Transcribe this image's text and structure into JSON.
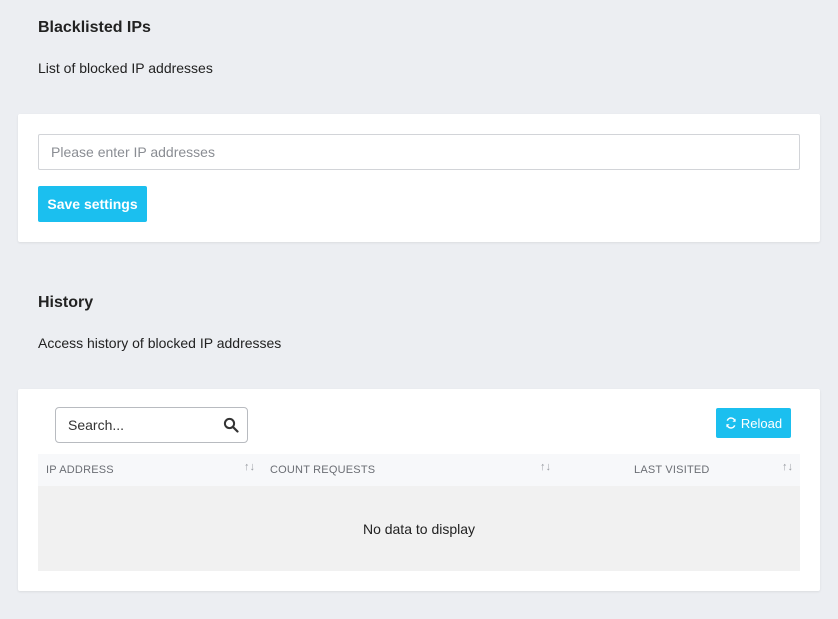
{
  "blacklist": {
    "title": "Blacklisted IPs",
    "description": "List of blocked IP addresses",
    "ip_input": {
      "value": "",
      "placeholder": "Please enter IP addresses"
    },
    "save_label": "Save settings"
  },
  "history": {
    "title": "History",
    "description": "Access history of blocked IP addresses",
    "search": {
      "value": "",
      "placeholder": "Search..."
    },
    "reload_label": "Reload",
    "columns": [
      {
        "label": "IP ADDRESS"
      },
      {
        "label": "COUNT REQUESTS"
      },
      {
        "label": "LAST VISITED"
      }
    ],
    "empty_text": "No data to display"
  },
  "icons": {
    "search": "search-icon",
    "reload": "refresh-icon",
    "sort": "sort-arrows-icon"
  },
  "colors": {
    "page_background": "#eceef2",
    "accent": "#1bbfef",
    "card_background": "#ffffff",
    "empty_background": "#f1f1f1"
  }
}
